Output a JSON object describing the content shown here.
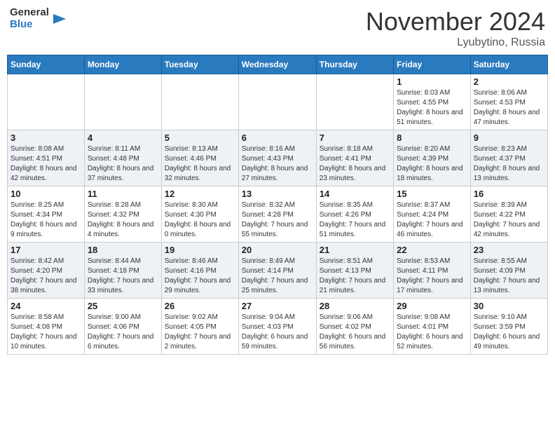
{
  "header": {
    "logo": {
      "general": "General",
      "blue": "Blue"
    },
    "title": "November 2024",
    "location": "Lyubytino, Russia"
  },
  "weekdays": [
    "Sunday",
    "Monday",
    "Tuesday",
    "Wednesday",
    "Thursday",
    "Friday",
    "Saturday"
  ],
  "weeks": [
    [
      {
        "day": "",
        "info": ""
      },
      {
        "day": "",
        "info": ""
      },
      {
        "day": "",
        "info": ""
      },
      {
        "day": "",
        "info": ""
      },
      {
        "day": "",
        "info": ""
      },
      {
        "day": "1",
        "info": "Sunrise: 8:03 AM\nSunset: 4:55 PM\nDaylight: 8 hours and 51 minutes."
      },
      {
        "day": "2",
        "info": "Sunrise: 8:06 AM\nSunset: 4:53 PM\nDaylight: 8 hours and 47 minutes."
      }
    ],
    [
      {
        "day": "3",
        "info": "Sunrise: 8:08 AM\nSunset: 4:51 PM\nDaylight: 8 hours and 42 minutes."
      },
      {
        "day": "4",
        "info": "Sunrise: 8:11 AM\nSunset: 4:48 PM\nDaylight: 8 hours and 37 minutes."
      },
      {
        "day": "5",
        "info": "Sunrise: 8:13 AM\nSunset: 4:46 PM\nDaylight: 8 hours and 32 minutes."
      },
      {
        "day": "6",
        "info": "Sunrise: 8:16 AM\nSunset: 4:43 PM\nDaylight: 8 hours and 27 minutes."
      },
      {
        "day": "7",
        "info": "Sunrise: 8:18 AM\nSunset: 4:41 PM\nDaylight: 8 hours and 23 minutes."
      },
      {
        "day": "8",
        "info": "Sunrise: 8:20 AM\nSunset: 4:39 PM\nDaylight: 8 hours and 18 minutes."
      },
      {
        "day": "9",
        "info": "Sunrise: 8:23 AM\nSunset: 4:37 PM\nDaylight: 8 hours and 13 minutes."
      }
    ],
    [
      {
        "day": "10",
        "info": "Sunrise: 8:25 AM\nSunset: 4:34 PM\nDaylight: 8 hours and 9 minutes."
      },
      {
        "day": "11",
        "info": "Sunrise: 8:28 AM\nSunset: 4:32 PM\nDaylight: 8 hours and 4 minutes."
      },
      {
        "day": "12",
        "info": "Sunrise: 8:30 AM\nSunset: 4:30 PM\nDaylight: 8 hours and 0 minutes."
      },
      {
        "day": "13",
        "info": "Sunrise: 8:32 AM\nSunset: 4:28 PM\nDaylight: 7 hours and 55 minutes."
      },
      {
        "day": "14",
        "info": "Sunrise: 8:35 AM\nSunset: 4:26 PM\nDaylight: 7 hours and 51 minutes."
      },
      {
        "day": "15",
        "info": "Sunrise: 8:37 AM\nSunset: 4:24 PM\nDaylight: 7 hours and 46 minutes."
      },
      {
        "day": "16",
        "info": "Sunrise: 8:39 AM\nSunset: 4:22 PM\nDaylight: 7 hours and 42 minutes."
      }
    ],
    [
      {
        "day": "17",
        "info": "Sunrise: 8:42 AM\nSunset: 4:20 PM\nDaylight: 7 hours and 38 minutes."
      },
      {
        "day": "18",
        "info": "Sunrise: 8:44 AM\nSunset: 4:18 PM\nDaylight: 7 hours and 33 minutes."
      },
      {
        "day": "19",
        "info": "Sunrise: 8:46 AM\nSunset: 4:16 PM\nDaylight: 7 hours and 29 minutes."
      },
      {
        "day": "20",
        "info": "Sunrise: 8:49 AM\nSunset: 4:14 PM\nDaylight: 7 hours and 25 minutes."
      },
      {
        "day": "21",
        "info": "Sunrise: 8:51 AM\nSunset: 4:13 PM\nDaylight: 7 hours and 21 minutes."
      },
      {
        "day": "22",
        "info": "Sunrise: 8:53 AM\nSunset: 4:11 PM\nDaylight: 7 hours and 17 minutes."
      },
      {
        "day": "23",
        "info": "Sunrise: 8:55 AM\nSunset: 4:09 PM\nDaylight: 7 hours and 13 minutes."
      }
    ],
    [
      {
        "day": "24",
        "info": "Sunrise: 8:58 AM\nSunset: 4:08 PM\nDaylight: 7 hours and 10 minutes."
      },
      {
        "day": "25",
        "info": "Sunrise: 9:00 AM\nSunset: 4:06 PM\nDaylight: 7 hours and 6 minutes."
      },
      {
        "day": "26",
        "info": "Sunrise: 9:02 AM\nSunset: 4:05 PM\nDaylight: 7 hours and 2 minutes."
      },
      {
        "day": "27",
        "info": "Sunrise: 9:04 AM\nSunset: 4:03 PM\nDaylight: 6 hours and 59 minutes."
      },
      {
        "day": "28",
        "info": "Sunrise: 9:06 AM\nSunset: 4:02 PM\nDaylight: 6 hours and 56 minutes."
      },
      {
        "day": "29",
        "info": "Sunrise: 9:08 AM\nSunset: 4:01 PM\nDaylight: 6 hours and 52 minutes."
      },
      {
        "day": "30",
        "info": "Sunrise: 9:10 AM\nSunset: 3:59 PM\nDaylight: 6 hours and 49 minutes."
      }
    ]
  ]
}
